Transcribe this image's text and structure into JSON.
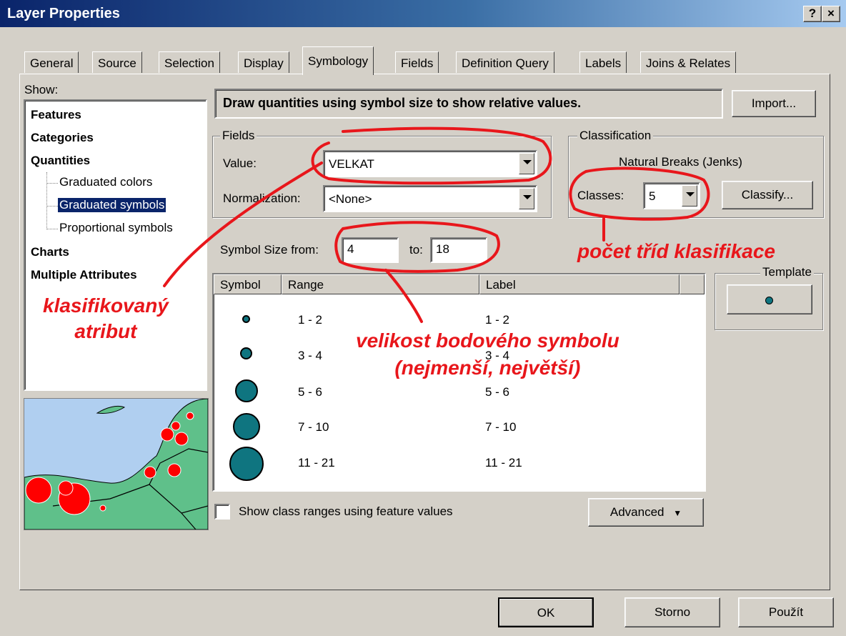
{
  "window": {
    "title": "Layer Properties",
    "help_btn": "?",
    "close_btn": "×"
  },
  "tabs": [
    {
      "label": "General"
    },
    {
      "label": "Source"
    },
    {
      "label": "Selection"
    },
    {
      "label": "Display"
    },
    {
      "label": "Symbology"
    },
    {
      "label": "Fields"
    },
    {
      "label": "Definition Query"
    },
    {
      "label": "Labels"
    },
    {
      "label": "Joins & Relates"
    }
  ],
  "active_tab": "Symbology",
  "show": {
    "label": "Show:",
    "items": [
      {
        "label": "Features",
        "level": 0
      },
      {
        "label": "Categories",
        "level": 0
      },
      {
        "label": "Quantities",
        "level": 0
      },
      {
        "label": "Graduated colors",
        "level": 1
      },
      {
        "label": "Graduated symbols",
        "level": 1,
        "selected": true
      },
      {
        "label": "Proportional symbols",
        "level": 1
      },
      {
        "label": "Charts",
        "level": 0
      },
      {
        "label": "Multiple Attributes",
        "level": 0
      }
    ]
  },
  "description": "Draw quantities using symbol size to show relative values.",
  "import_btn": "Import...",
  "fields": {
    "label": "Fields",
    "value_label": "Value:",
    "value": "VELKAT",
    "normalization_label": "Normalization:",
    "normalization": "<None>"
  },
  "classification": {
    "label": "Classification",
    "method": "Natural Breaks (Jenks)",
    "classes_label": "Classes:",
    "classes": "5",
    "classify_btn": "Classify..."
  },
  "symbol_size": {
    "from_label": "Symbol Size from:",
    "from": "4",
    "to_label": "to:",
    "to": "18"
  },
  "template": {
    "label": "Template"
  },
  "table": {
    "headers": [
      "Symbol",
      "Range",
      "Label"
    ],
    "rows": [
      {
        "range": "1 - 2",
        "label": "1 - 2"
      },
      {
        "range": "3 - 4",
        "label": "3 - 4"
      },
      {
        "range": "5 - 6",
        "label": "5 - 6"
      },
      {
        "range": "7 - 10",
        "label": "7 - 10"
      },
      {
        "range": "11 - 21",
        "label": "11 - 21"
      }
    ]
  },
  "show_class_ranges": "Show class ranges using feature values",
  "advanced_btn": "Advanced",
  "buttons": {
    "ok": "OK",
    "cancel": "Storno",
    "apply": "Použít"
  },
  "annotations": {
    "attribute": "klasifikovaný\natribut",
    "classes": "počet tříd klasifikace",
    "symbol_size": "velikost bodového symbolu\n(nejmenší, největší)"
  },
  "colors": {
    "symbol": "#0f7580",
    "annotation": "#e8161b",
    "map_water": "#b0cff0",
    "map_land": "#5fc08a",
    "map_point": "#ff0000"
  }
}
